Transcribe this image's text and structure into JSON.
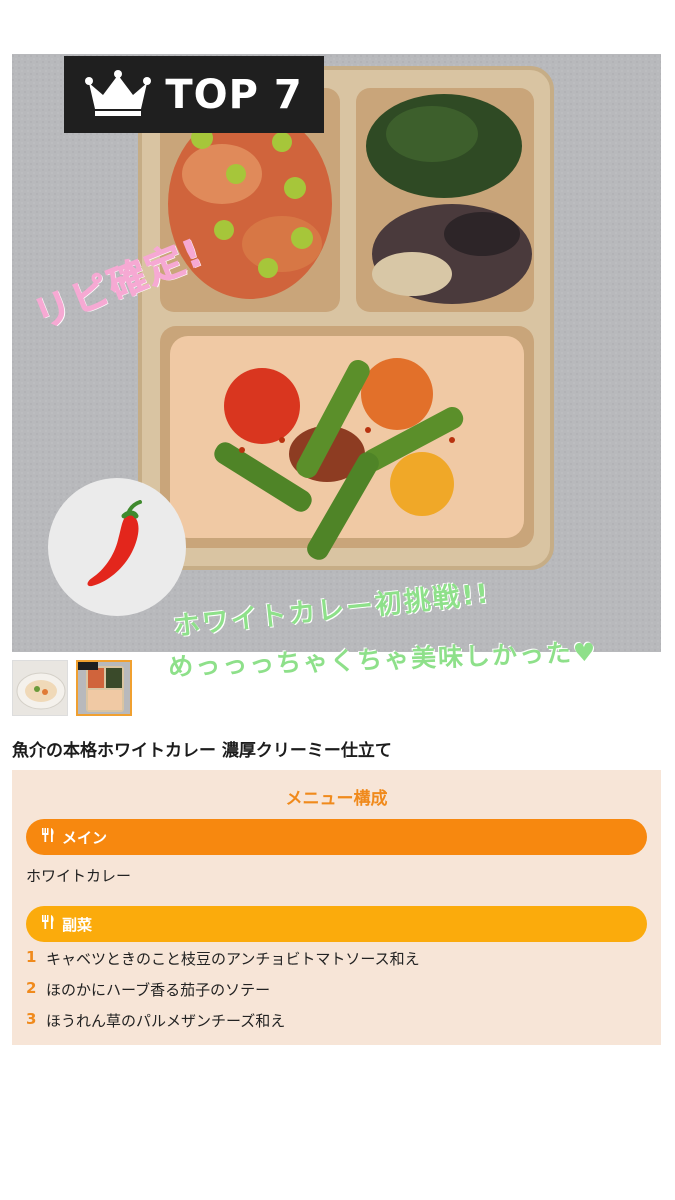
{
  "hero": {
    "badge_text": "TOP 7",
    "badge_icon": "crown-icon",
    "spice_icon": "chili-pepper-icon",
    "handwriting": {
      "pink": "リピ確定!",
      "green_line1": "ホワイトカレー初挑戦!!",
      "green_line2": "めっっっちゃくちゃ美味しかった♥"
    }
  },
  "thumbnails": [
    {
      "name": "thumb-curry-plate",
      "selected": false
    },
    {
      "name": "thumb-bento-box",
      "selected": true
    }
  ],
  "product": {
    "title": "魚介の本格ホワイトカレー 濃厚クリーミー仕立て"
  },
  "menu": {
    "heading": "メニュー構成",
    "main": {
      "label": "メイン",
      "item": "ホワイトカレー"
    },
    "side": {
      "label": "副菜",
      "items": [
        {
          "num": "1",
          "text": "キャベツときのこと枝豆のアンチョビトマトソース和え"
        },
        {
          "num": "2",
          "text": "ほのかにハーブ香る茄子のソテー"
        },
        {
          "num": "3",
          "text": "ほうれん草のパルメザンチーズ和え"
        }
      ]
    }
  },
  "colors": {
    "accent_orange": "#f7880f",
    "accent_yellow": "#fbab0c",
    "panel_bg": "#f7e5d7",
    "handwriting_pink": "#f6a9d3",
    "handwriting_green": "#8ee08a"
  }
}
